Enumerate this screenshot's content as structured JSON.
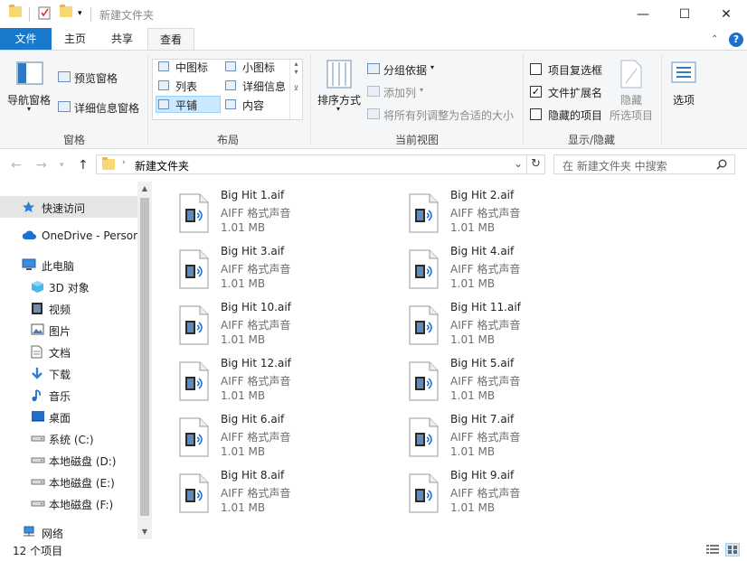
{
  "window": {
    "title": "新建文件夹",
    "minimize": "—",
    "maximize": "☐",
    "close": "✕"
  },
  "tabs": [
    {
      "label": "文件"
    },
    {
      "label": "主页"
    },
    {
      "label": "共享"
    },
    {
      "label": "查看"
    }
  ],
  "help_label": "?",
  "ribbon": {
    "panes": {
      "nav_pane": "导航窗格",
      "preview_pane": "预览窗格",
      "details_pane": "详细信息窗格",
      "label": "窗格"
    },
    "layout": {
      "medium_icons": "中图标",
      "small_icons": "小图标",
      "list": "列表",
      "details": "详细信息",
      "tiles": "平铺",
      "content": "内容",
      "label": "布局"
    },
    "current_view": {
      "sort_by": "排序方式",
      "group_by": "分组依据",
      "add_columns": "添加列",
      "size_all_columns": "将所有列调整为合适的大小",
      "label": "当前视图"
    },
    "show_hide": {
      "item_checkboxes": "项目复选框",
      "item_checkboxes_checked": false,
      "file_extensions": "文件扩展名",
      "file_extensions_checked": true,
      "hidden_items": "隐藏的项目",
      "hidden_items_checked": false,
      "hide_selected": "隐藏",
      "hide_selected_sub": "所选项目",
      "label": "显示/隐藏"
    },
    "options": "选项"
  },
  "address": {
    "path": "新建文件夹",
    "search_placeholder": "在 新建文件夹 中搜索"
  },
  "sidebar": {
    "items": [
      {
        "label": "快速访问",
        "icon": "star-icon"
      },
      {
        "label": "OneDrive - Person",
        "icon": "cloud-icon"
      },
      {
        "label": "此电脑",
        "icon": "computer-icon"
      },
      {
        "label": "3D 对象",
        "icon": "cube-icon"
      },
      {
        "label": "视频",
        "icon": "video-icon"
      },
      {
        "label": "图片",
        "icon": "picture-icon"
      },
      {
        "label": "文档",
        "icon": "document-icon"
      },
      {
        "label": "下载",
        "icon": "download-icon"
      },
      {
        "label": "音乐",
        "icon": "music-icon"
      },
      {
        "label": "桌面",
        "icon": "desktop-icon"
      },
      {
        "label": "系统 (C:)",
        "icon": "drive-icon"
      },
      {
        "label": "本地磁盘 (D:)",
        "icon": "drive-icon"
      },
      {
        "label": "本地磁盘 (E:)",
        "icon": "drive-icon"
      },
      {
        "label": "本地磁盘 (F:)",
        "icon": "drive-icon"
      },
      {
        "label": "网络",
        "icon": "network-icon"
      }
    ]
  },
  "files": [
    {
      "name": "Big Hit 1.aif",
      "type": "AIFF 格式声音",
      "size": "1.01 MB"
    },
    {
      "name": "Big Hit 2.aif",
      "type": "AIFF 格式声音",
      "size": "1.01 MB"
    },
    {
      "name": "Big Hit 3.aif",
      "type": "AIFF 格式声音",
      "size": "1.01 MB"
    },
    {
      "name": "Big Hit 4.aif",
      "type": "AIFF 格式声音",
      "size": "1.01 MB"
    },
    {
      "name": "Big Hit 10.aif",
      "type": "AIFF 格式声音",
      "size": "1.01 MB"
    },
    {
      "name": "Big Hit 11.aif",
      "type": "AIFF 格式声音",
      "size": "1.01 MB"
    },
    {
      "name": "Big Hit 12.aif",
      "type": "AIFF 格式声音",
      "size": "1.01 MB"
    },
    {
      "name": "Big Hit 5.aif",
      "type": "AIFF 格式声音",
      "size": "1.01 MB"
    },
    {
      "name": "Big Hit 6.aif",
      "type": "AIFF 格式声音",
      "size": "1.01 MB"
    },
    {
      "name": "Big Hit 7.aif",
      "type": "AIFF 格式声音",
      "size": "1.01 MB"
    },
    {
      "name": "Big Hit 8.aif",
      "type": "AIFF 格式声音",
      "size": "1.01 MB"
    },
    {
      "name": "Big Hit 9.aif",
      "type": "AIFF 格式声音",
      "size": "1.01 MB"
    }
  ],
  "status": {
    "item_count": "12 个项目"
  },
  "colors": {
    "file_tab": "#1979ca",
    "selection": "#cce8ff",
    "folder": "#f8d775"
  }
}
